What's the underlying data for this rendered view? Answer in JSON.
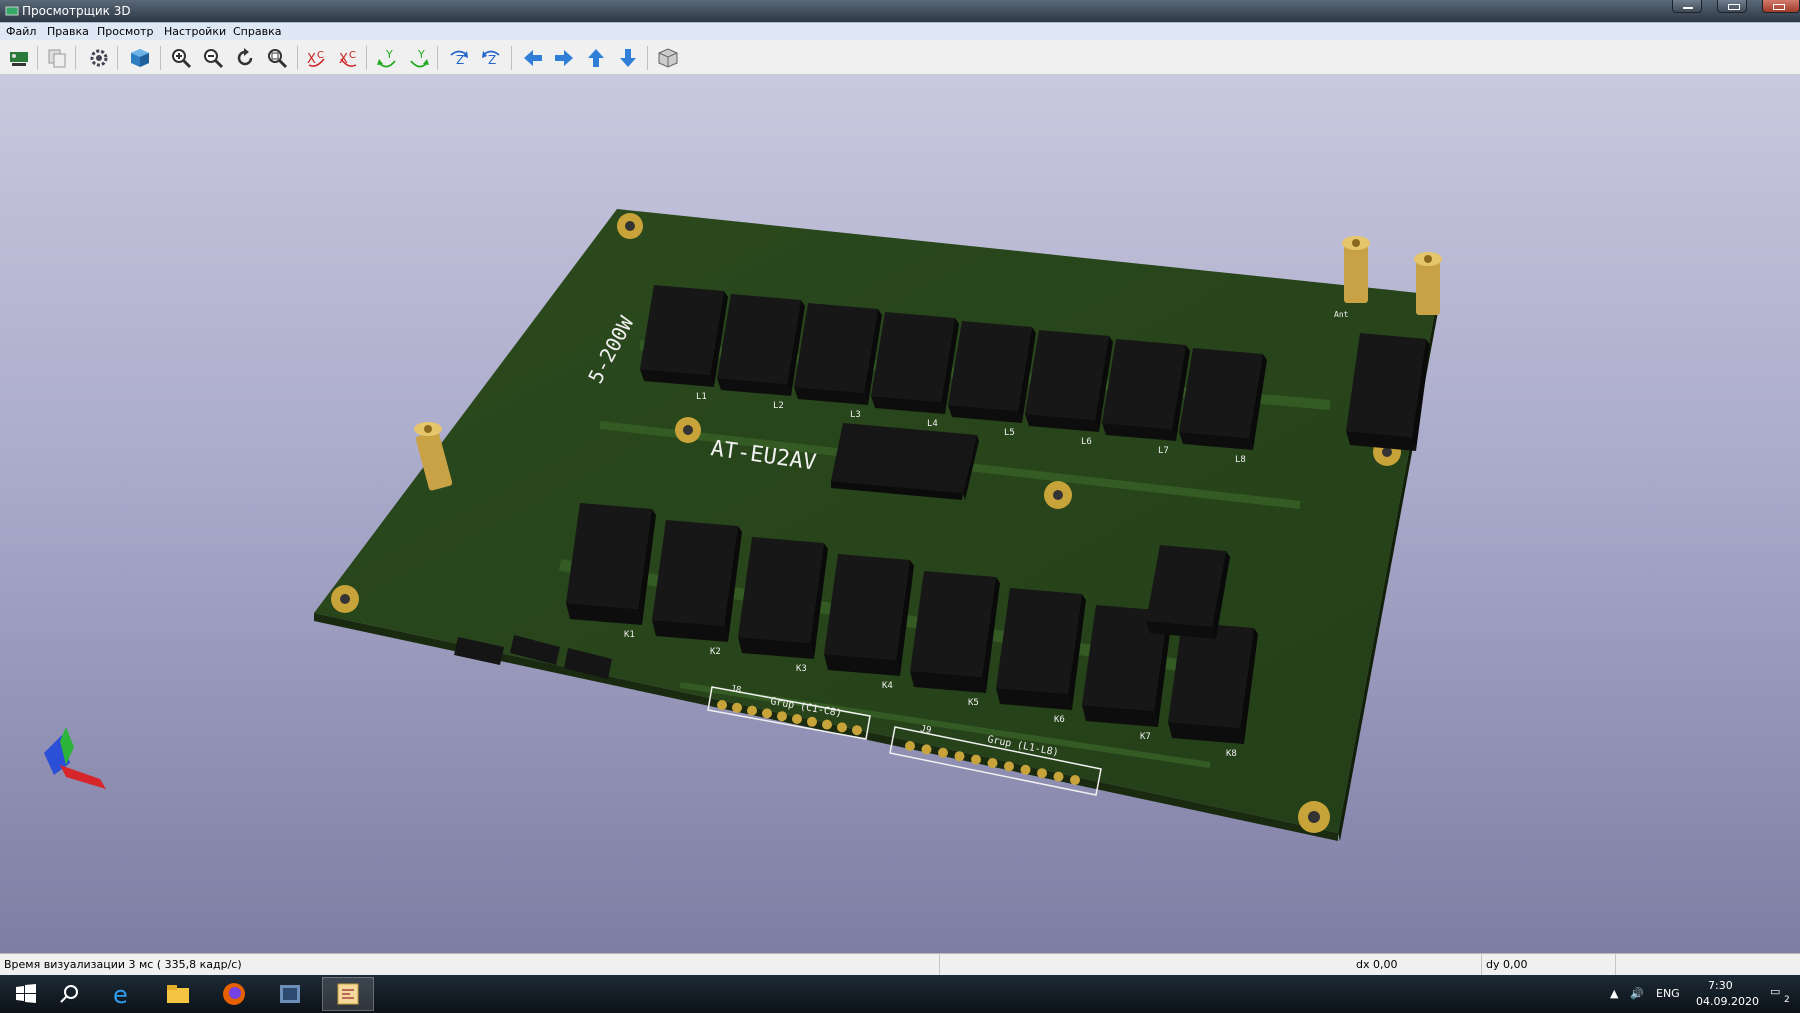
{
  "window": {
    "title": "Просмотрщик 3D"
  },
  "menu": {
    "items": [
      "Файл",
      "Правка",
      "Просмотр",
      "Настройки",
      "Справка"
    ]
  },
  "toolbar": {
    "buttons": [
      "reload-board",
      "copy-image",
      "settings",
      "3d-view-toggle",
      "zoom-in",
      "zoom-out",
      "redraw",
      "zoom-fit",
      "rotate-x-cw",
      "rotate-x-ccw",
      "rotate-y-cw",
      "rotate-y-ccw",
      "rotate-z-cw",
      "rotate-z-ccw",
      "move-left",
      "move-right",
      "move-up",
      "move-down",
      "ortho-view"
    ]
  },
  "board": {
    "title_silk": "AT-EU2AV",
    "side_silk": "5-200W",
    "connector_j8_label": "Grup (C1-C8)",
    "connector_j9_label": "Grup (L1-L8)",
    "j8_ref": "J8",
    "j9_ref": "J9",
    "relay_top_refs": [
      "L1",
      "L2",
      "L3",
      "L4",
      "L5",
      "L6",
      "L7",
      "L8"
    ],
    "relay_bottom_refs": [
      "K1",
      "K2",
      "K3",
      "K4",
      "K5",
      "K6",
      "K7",
      "K8"
    ],
    "antenna_label": "Ant",
    "colors": {
      "pcb": "#2d4a1e",
      "silk": "#f0f0f0",
      "gold": "#c8a33a",
      "relay": "#141414"
    }
  },
  "status": {
    "render_time": "Время визуализации 3 мс ( 335,8 кадр/с)",
    "dx": "dx 0,00",
    "dy": "dy 0,00"
  },
  "taskbar": {
    "language": "ENG",
    "time": "7:30",
    "date": "04.09.2020",
    "notifications": "2"
  }
}
